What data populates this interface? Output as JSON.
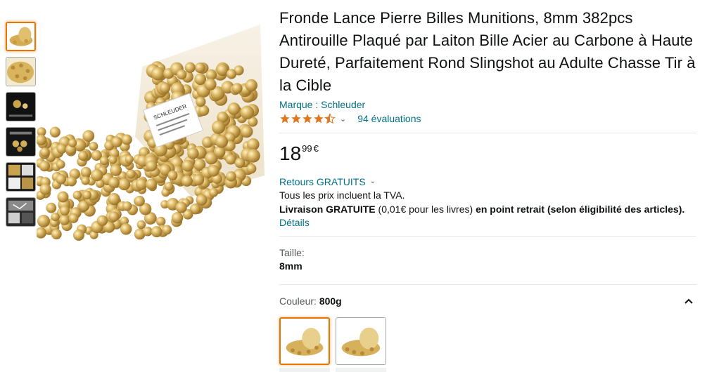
{
  "gallery": {
    "thumbnails": [
      {
        "name": "thumb-bag-bullets",
        "selected": true
      },
      {
        "name": "thumb-pile-bullets",
        "selected": false
      },
      {
        "name": "thumb-dark-feature",
        "selected": false
      },
      {
        "name": "thumb-dark-grid",
        "selected": false
      },
      {
        "name": "thumb-dark-collage",
        "selected": false
      },
      {
        "name": "thumb-slingshot-collage",
        "selected": false
      }
    ],
    "bag_label": "SCHLEUDER"
  },
  "product": {
    "title": "Fronde Lance Pierre Billes Munitions, 8mm 382pcs Antirouille Plaqué par Laiton Bille Acier au Carbone à Haute Dureté, Parfaitement Rond Slingshot au Adulte Chasse Tir à la Cible",
    "brand": "Marque : Schleuder",
    "rating_value": 4.5,
    "reviews": "94 évaluations",
    "price_whole": "18",
    "price_fraction": "99",
    "price_symbol": "€",
    "returns": "Retours GRATUITS",
    "tax_note": "Tous les prix incluent la TVA.",
    "delivery_bold": "Livraison GRATUITE",
    "delivery_normal": " (0,01€ pour les livres) ",
    "delivery_bold2": "en point retrait (selon éligibilité des articles).",
    "details": "Détails",
    "size_label": "Taille:",
    "size_value": "8mm",
    "color_label": "Couleur: ",
    "color_value": "800g"
  },
  "colors": {
    "link": "#007185",
    "star": "#de7921",
    "selected_border": "#e77600",
    "gold": "#d9b45a"
  }
}
